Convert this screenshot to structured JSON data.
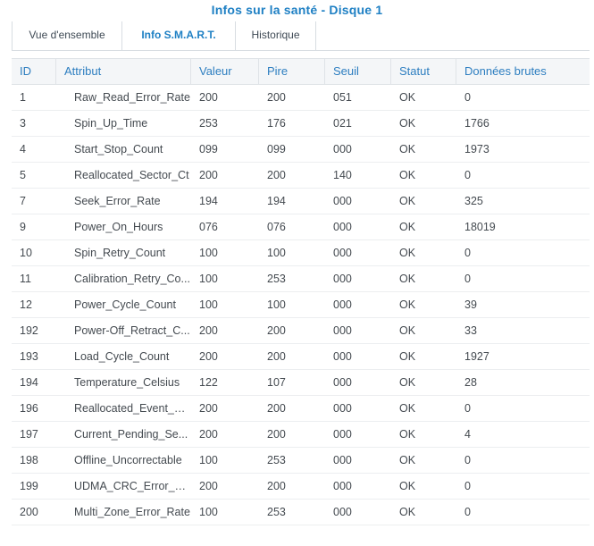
{
  "window": {
    "title": "Infos sur la santé - Disque 1"
  },
  "tabs": [
    {
      "label": "Vue d'ensemble",
      "active": false
    },
    {
      "label": "Info S.M.A.R.T.",
      "active": true
    },
    {
      "label": "Historique",
      "active": false
    }
  ],
  "table": {
    "columns": [
      "ID",
      "Attribut",
      "Valeur",
      "Pire",
      "Seuil",
      "Statut",
      "Données brutes"
    ],
    "rows": [
      [
        "1",
        "Raw_Read_Error_Rate",
        "200",
        "200",
        "051",
        "OK",
        "0"
      ],
      [
        "3",
        "Spin_Up_Time",
        "253",
        "176",
        "021",
        "OK",
        "1766"
      ],
      [
        "4",
        "Start_Stop_Count",
        "099",
        "099",
        "000",
        "OK",
        "1973"
      ],
      [
        "5",
        "Reallocated_Sector_Ct",
        "200",
        "200",
        "140",
        "OK",
        "0"
      ],
      [
        "7",
        "Seek_Error_Rate",
        "194",
        "194",
        "000",
        "OK",
        "325"
      ],
      [
        "9",
        "Power_On_Hours",
        "076",
        "076",
        "000",
        "OK",
        "18019"
      ],
      [
        "10",
        "Spin_Retry_Count",
        "100",
        "100",
        "000",
        "OK",
        "0"
      ],
      [
        "11",
        "Calibration_Retry_Co...",
        "100",
        "253",
        "000",
        "OK",
        "0"
      ],
      [
        "12",
        "Power_Cycle_Count",
        "100",
        "100",
        "000",
        "OK",
        "39"
      ],
      [
        "192",
        "Power-Off_Retract_C...",
        "200",
        "200",
        "000",
        "OK",
        "33"
      ],
      [
        "193",
        "Load_Cycle_Count",
        "200",
        "200",
        "000",
        "OK",
        "1927"
      ],
      [
        "194",
        "Temperature_Celsius",
        "122",
        "107",
        "000",
        "OK",
        "28"
      ],
      [
        "196",
        "Reallocated_Event_C...",
        "200",
        "200",
        "000",
        "OK",
        "0"
      ],
      [
        "197",
        "Current_Pending_Se...",
        "200",
        "200",
        "000",
        "OK",
        "4"
      ],
      [
        "198",
        "Offline_Uncorrectable",
        "100",
        "253",
        "000",
        "OK",
        "0"
      ],
      [
        "199",
        "UDMA_CRC_Error_Co...",
        "200",
        "200",
        "000",
        "OK",
        "0"
      ],
      [
        "200",
        "Multi_Zone_Error_Rate",
        "100",
        "253",
        "000",
        "OK",
        "0"
      ]
    ]
  }
}
